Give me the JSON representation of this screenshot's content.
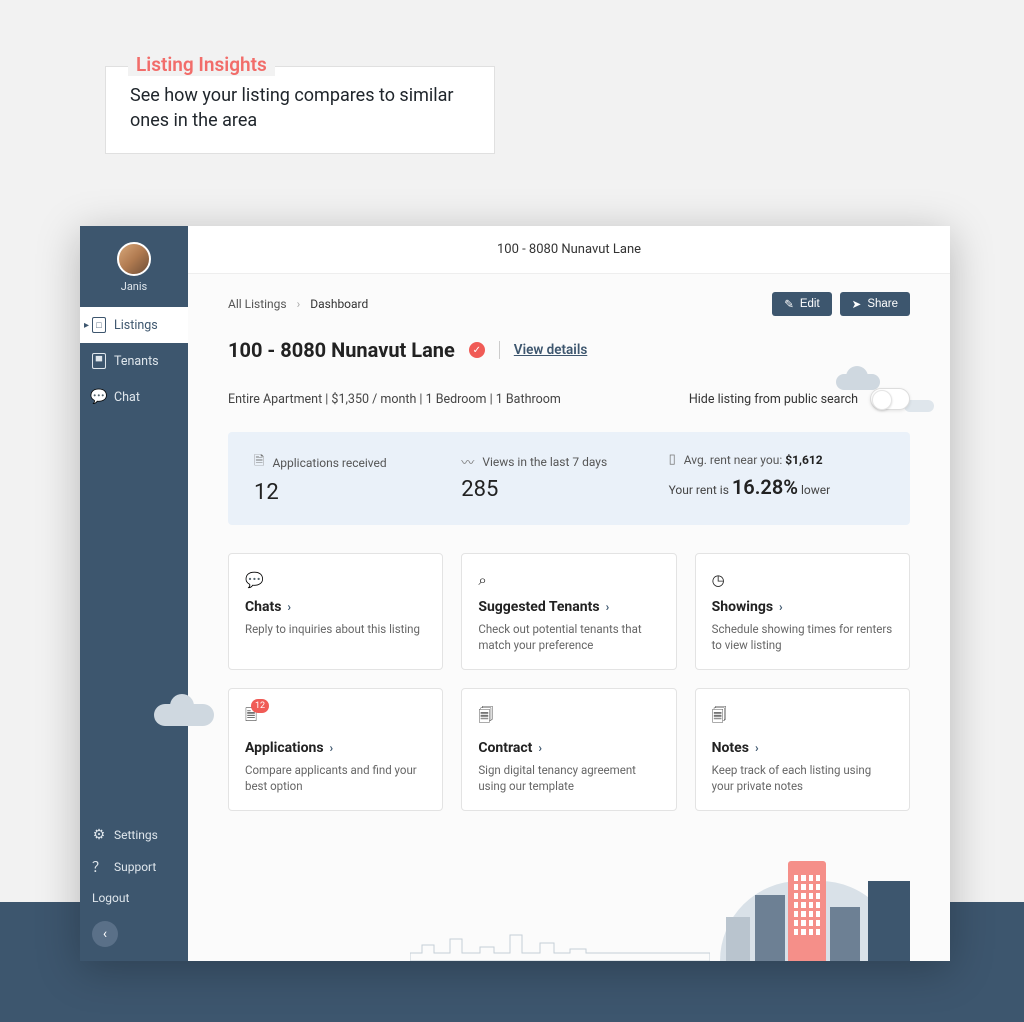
{
  "insights": {
    "title": "Listing Insights",
    "desc": "See how your listing compares to similar ones in the area"
  },
  "user": {
    "name": "Janis"
  },
  "sidebar": {
    "primary": [
      {
        "label": "Listings"
      },
      {
        "label": "Tenants"
      },
      {
        "label": "Chat"
      }
    ],
    "secondary": [
      {
        "label": "Settings"
      },
      {
        "label": "Support"
      },
      {
        "label": "Logout"
      }
    ]
  },
  "topbar": {
    "title": "100 - 8080 Nunavut Lane"
  },
  "breadcrumbs": {
    "root": "All Listings",
    "current": "Dashboard"
  },
  "actions": {
    "edit": "Edit",
    "share": "Share"
  },
  "listing": {
    "title": "100 - 8080 Nunavut Lane",
    "view_details": "View details",
    "meta": "Entire Apartment | $1,350 / month | 1 Bedroom | 1 Bathroom"
  },
  "hide_toggle": {
    "label": "Hide listing from public search",
    "on": false
  },
  "stats": {
    "apps": {
      "label": "Applications received",
      "value": "12"
    },
    "views": {
      "label": "Views in the last 7 days",
      "value": "285"
    },
    "rent": {
      "label_prefix": "Avg. rent near you:",
      "avg_value": "$1,612",
      "line_prefix": "Your rent is",
      "pct": "16.28%",
      "line_suffix": "lower"
    }
  },
  "cards": {
    "chats": {
      "title": "Chats",
      "desc": "Reply to inquiries about this listing"
    },
    "suggested": {
      "title": "Suggested Tenants",
      "desc": "Check out potential tenants that match your preference"
    },
    "showings": {
      "title": "Showings",
      "desc": "Schedule showing times for renters to view listing"
    },
    "applications": {
      "title": "Applications",
      "badge": "12",
      "desc": "Compare applicants and find your best option"
    },
    "contract": {
      "title": "Contract",
      "desc": "Sign digital tenancy agreement using our template"
    },
    "notes": {
      "title": "Notes",
      "desc": "Keep track of each listing using your private notes"
    }
  }
}
